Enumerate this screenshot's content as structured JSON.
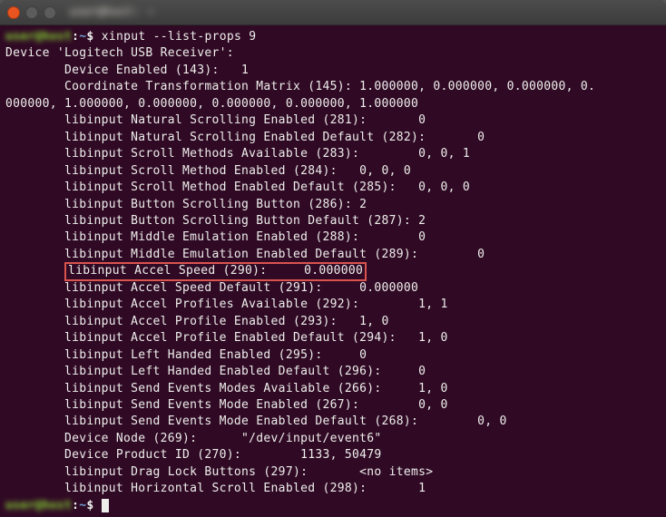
{
  "titlebar": {
    "text": "user@host: ~"
  },
  "prompt1": {
    "userhost": "user@host",
    "sep": ":",
    "path": "~",
    "dollar": "$ ",
    "command": "xinput --list-props 9"
  },
  "output": {
    "l0": "Device 'Logitech USB Receiver':",
    "l1": "        Device Enabled (143):   1",
    "l2": "        Coordinate Transformation Matrix (145): 1.000000, 0.000000, 0.000000, 0.",
    "l3": "000000, 1.000000, 0.000000, 0.000000, 0.000000, 1.000000",
    "l4": "        libinput Natural Scrolling Enabled (281):       0",
    "l5": "        libinput Natural Scrolling Enabled Default (282):       0",
    "l6": "        libinput Scroll Methods Available (283):        0, 0, 1",
    "l7": "        libinput Scroll Method Enabled (284):   0, 0, 0",
    "l8": "        libinput Scroll Method Enabled Default (285):   0, 0, 0",
    "l9": "        libinput Button Scrolling Button (286): 2",
    "l10": "        libinput Button Scrolling Button Default (287): 2",
    "l11": "        libinput Middle Emulation Enabled (288):        0",
    "l12": "        libinput Middle Emulation Enabled Default (289):        0",
    "hl_prefix": "        ",
    "hl_text": "libinput Accel Speed (290):     0.000000",
    "l14": "        libinput Accel Speed Default (291):     0.000000",
    "l15": "        libinput Accel Profiles Available (292):        1, 1",
    "l16": "        libinput Accel Profile Enabled (293):   1, 0",
    "l17": "        libinput Accel Profile Enabled Default (294):   1, 0",
    "l18": "        libinput Left Handed Enabled (295):     0",
    "l19": "        libinput Left Handed Enabled Default (296):     0",
    "l20": "        libinput Send Events Modes Available (266):     1, 0",
    "l21": "        libinput Send Events Mode Enabled (267):        0, 0",
    "l22": "        libinput Send Events Mode Enabled Default (268):        0, 0",
    "l23": "        Device Node (269):      \"/dev/input/event6\"",
    "l24": "        Device Product ID (270):        1133, 50479",
    "l25": "        libinput Drag Lock Buttons (297):       <no items>",
    "l26": "        libinput Horizontal Scroll Enabled (298):       1"
  },
  "prompt2": {
    "userhost": "user@host",
    "sep": ":",
    "path": "~",
    "dollar": "$ "
  },
  "chart_data": {
    "type": "table",
    "title": "xinput --list-props 9",
    "device": "Logitech USB Receiver",
    "properties": [
      {
        "name": "Device Enabled",
        "id": 143,
        "value": "1"
      },
      {
        "name": "Coordinate Transformation Matrix",
        "id": 145,
        "value": "1.000000, 0.000000, 0.000000, 0.000000, 1.000000, 0.000000, 0.000000, 0.000000, 1.000000"
      },
      {
        "name": "libinput Natural Scrolling Enabled",
        "id": 281,
        "value": "0"
      },
      {
        "name": "libinput Natural Scrolling Enabled Default",
        "id": 282,
        "value": "0"
      },
      {
        "name": "libinput Scroll Methods Available",
        "id": 283,
        "value": "0, 0, 1"
      },
      {
        "name": "libinput Scroll Method Enabled",
        "id": 284,
        "value": "0, 0, 0"
      },
      {
        "name": "libinput Scroll Method Enabled Default",
        "id": 285,
        "value": "0, 0, 0"
      },
      {
        "name": "libinput Button Scrolling Button",
        "id": 286,
        "value": "2"
      },
      {
        "name": "libinput Button Scrolling Button Default",
        "id": 287,
        "value": "2"
      },
      {
        "name": "libinput Middle Emulation Enabled",
        "id": 288,
        "value": "0"
      },
      {
        "name": "libinput Middle Emulation Enabled Default",
        "id": 289,
        "value": "0"
      },
      {
        "name": "libinput Accel Speed",
        "id": 290,
        "value": "0.000000",
        "highlighted": true
      },
      {
        "name": "libinput Accel Speed Default",
        "id": 291,
        "value": "0.000000"
      },
      {
        "name": "libinput Accel Profiles Available",
        "id": 292,
        "value": "1, 1"
      },
      {
        "name": "libinput Accel Profile Enabled",
        "id": 293,
        "value": "1, 0"
      },
      {
        "name": "libinput Accel Profile Enabled Default",
        "id": 294,
        "value": "1, 0"
      },
      {
        "name": "libinput Left Handed Enabled",
        "id": 295,
        "value": "0"
      },
      {
        "name": "libinput Left Handed Enabled Default",
        "id": 296,
        "value": "0"
      },
      {
        "name": "libinput Send Events Modes Available",
        "id": 266,
        "value": "1, 0"
      },
      {
        "name": "libinput Send Events Mode Enabled",
        "id": 267,
        "value": "0, 0"
      },
      {
        "name": "libinput Send Events Mode Enabled Default",
        "id": 268,
        "value": "0, 0"
      },
      {
        "name": "Device Node",
        "id": 269,
        "value": "\"/dev/input/event6\""
      },
      {
        "name": "Device Product ID",
        "id": 270,
        "value": "1133, 50479"
      },
      {
        "name": "libinput Drag Lock Buttons",
        "id": 297,
        "value": "<no items>"
      },
      {
        "name": "libinput Horizontal Scroll Enabled",
        "id": 298,
        "value": "1"
      }
    ]
  }
}
